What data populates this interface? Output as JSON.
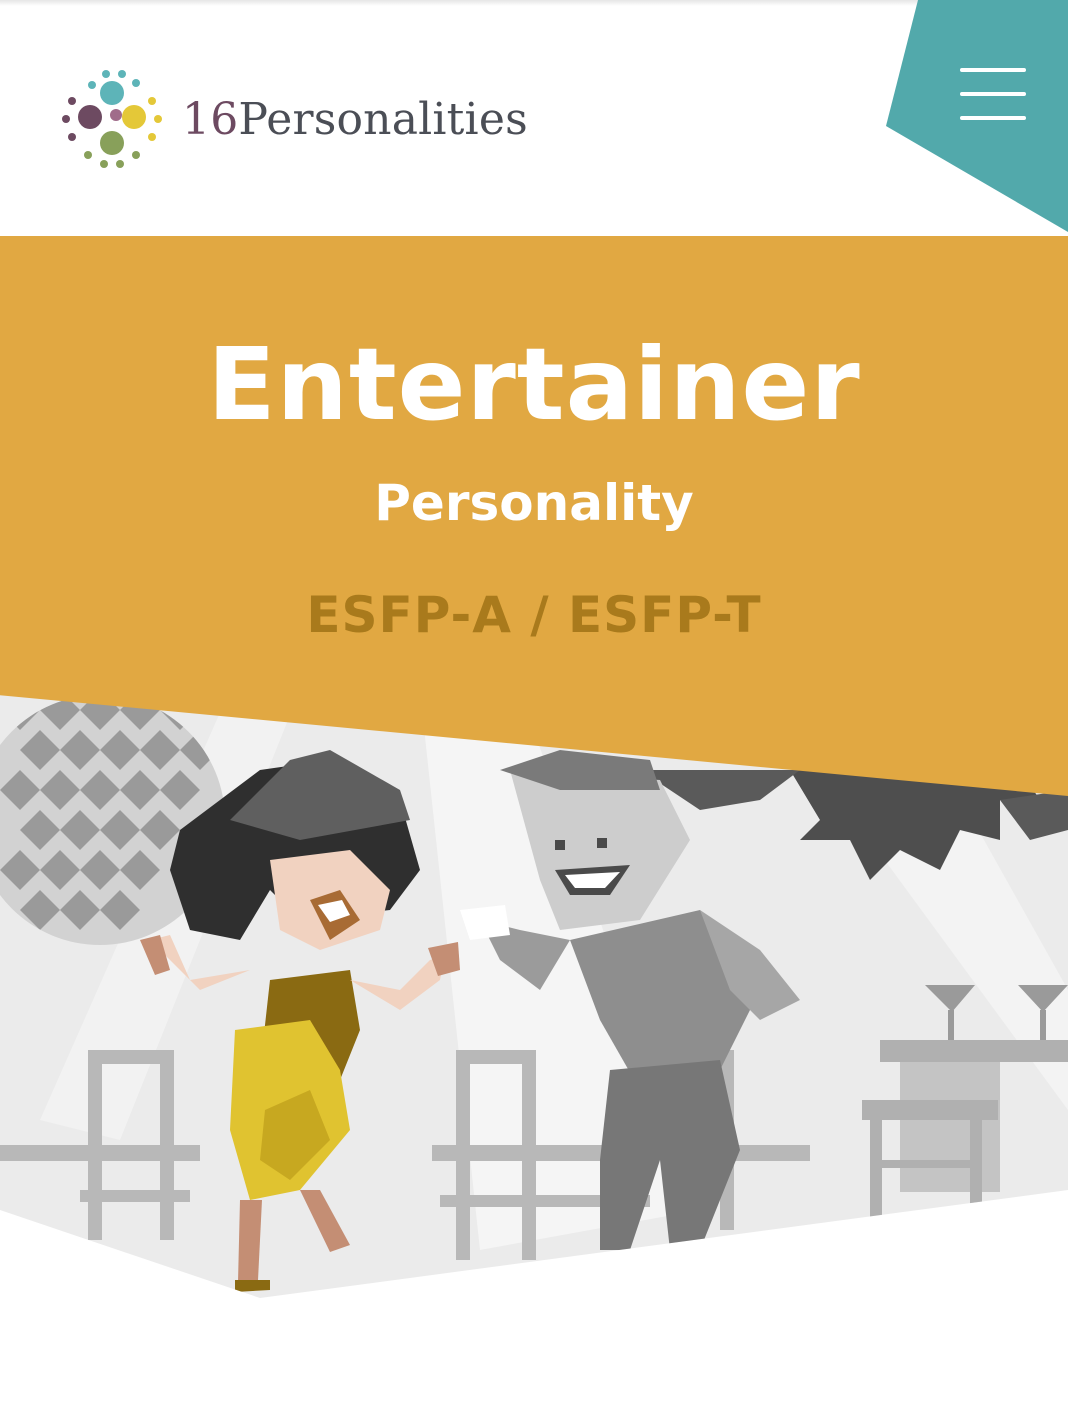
{
  "brand": {
    "number": "16",
    "name": "Personalities",
    "logo_colors": [
      "#5db4b8",
      "#6d4a61",
      "#e4c838",
      "#88a05a",
      "#a06c8a"
    ]
  },
  "header": {
    "menu_icon": "hamburger-icon",
    "accent_color": "#52a9ab"
  },
  "hero": {
    "title": "Entertainer",
    "subtitle": "Personality",
    "type_code": "ESFP-A / ESFP-T",
    "background_color": "#e1a842"
  },
  "illustration": {
    "subject": "party-dance-scene"
  }
}
